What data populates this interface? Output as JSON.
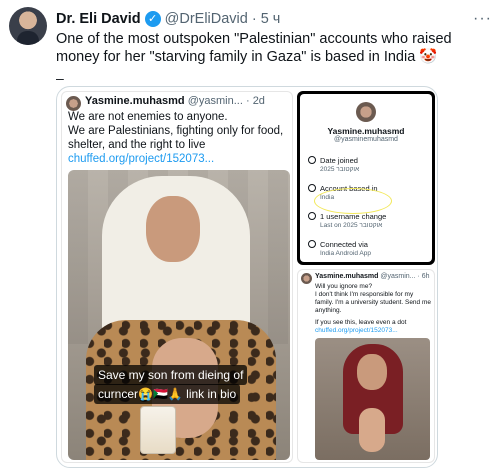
{
  "tweet": {
    "author_name": "Dr. Eli David",
    "handle": "@DrEliDavid",
    "separator": "·",
    "time": "5 ч",
    "more_label": "···",
    "text": "One of the most outspoken \"Palestinian\" accounts who raised money for her \"starving family in Gaza\" is based in India 🤡",
    "dash": "–"
  },
  "media": {
    "left_post": {
      "author": "Yasmine.muhasmd",
      "handle": "@yasmin...",
      "time": "· 2d",
      "line1": "We are not enemies to anyone.",
      "line2": "We are Palestinians, fighting only for food, shelter, and the right to live",
      "link": "chuffed.org/project/152073...",
      "caption1": "Save my son from dieing of",
      "caption2": "curncer😭🇸🇩🙏 link in bio"
    },
    "profile_card": {
      "name": "Yasmine.muhasmd",
      "handle": "@yasminemuhasmd",
      "rows": [
        {
          "label": "Date joined",
          "sub": "2025 אוקטובר"
        },
        {
          "label": "Account based in",
          "sub": "India"
        },
        {
          "label": "1 username change",
          "sub": "Last on 2025 אוקטובר"
        },
        {
          "label": "Connected via",
          "sub": "India Android App"
        }
      ]
    },
    "reply_post": {
      "author": "Yasmine.muhasmd",
      "handle": "@yasmin...",
      "time": "· 6h",
      "line1": "Will you ignore me?",
      "line2": "I don't think I'm responsible for my family. I'm a university student. Send me anything.",
      "line3": "If you see this, leave even a dot",
      "link": "chuffed.org/project/152073..."
    }
  }
}
